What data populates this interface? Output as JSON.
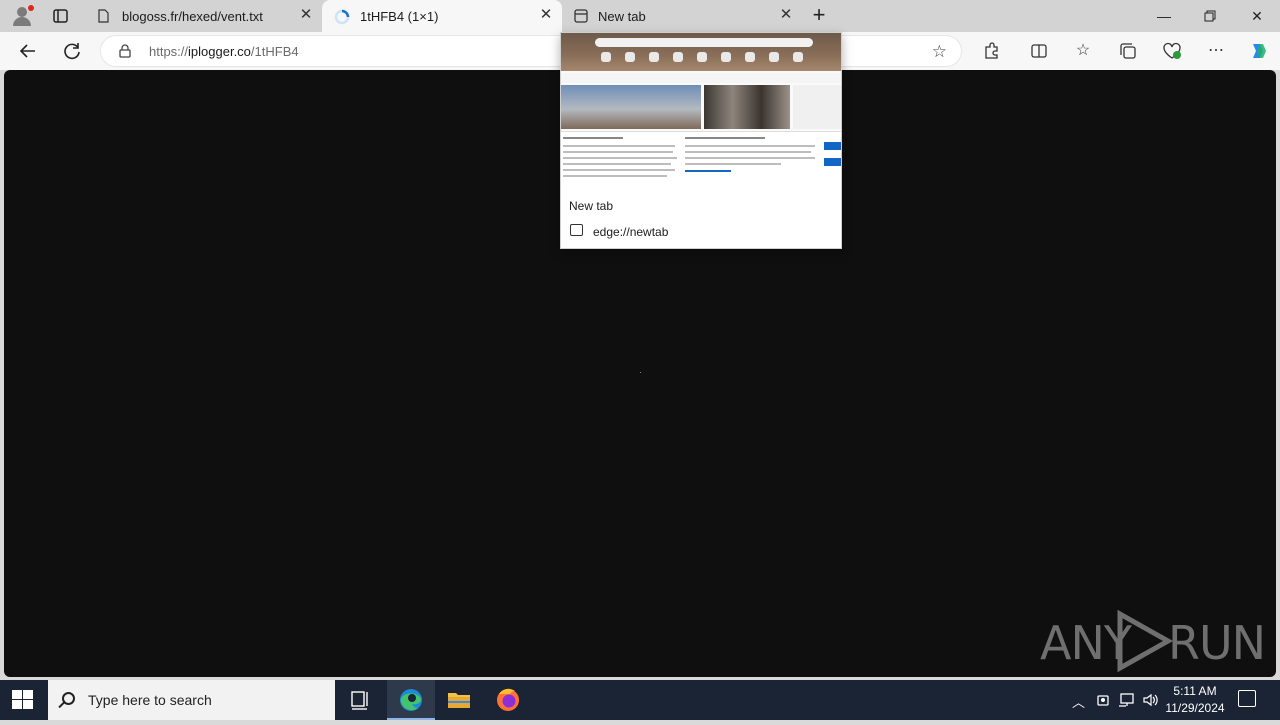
{
  "tabs": [
    {
      "title": "blogoss.fr/hexed/vent.txt",
      "icon": "document-icon"
    },
    {
      "title": "1tHFB4 (1×1)",
      "icon": "loading-spinner-icon"
    },
    {
      "title": "New tab",
      "icon": "newtab-icon"
    }
  ],
  "address": {
    "prefix": "https://",
    "host": "iplogger.co",
    "path": "/1tHFB4"
  },
  "preview": {
    "title": "New tab",
    "url": "edge://newtab"
  },
  "watermark": {
    "left": "ANY",
    "right": "RUN"
  },
  "taskbar": {
    "search_placeholder": "Type here to search",
    "time": "5:11 AM",
    "date": "11/29/2024"
  },
  "colors": {
    "accent": "#1266c4",
    "taskbar": "#1a2434",
    "content_bg": "#0f0f0f"
  }
}
